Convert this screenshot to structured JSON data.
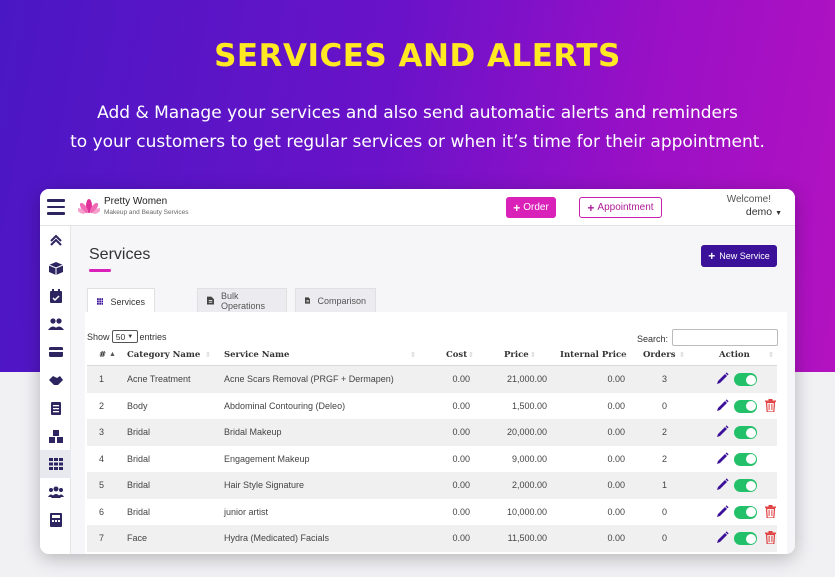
{
  "hero": {
    "title": "SERVICES AND ALERTS",
    "subtitle_line1": "Add & Manage your services and also send automatic alerts and reminders",
    "subtitle_line2": "to your customers to get regular services or when it’s time for their appointment."
  },
  "colors": {
    "accent_magenta": "#d920b9",
    "primary_purple": "#3b1199",
    "title_yellow": "#ffe923",
    "toggle_green": "#23c06a",
    "delete_red": "#e04040"
  },
  "topbar": {
    "brand_name": "Pretty Women",
    "brand_tagline": "Makeup and Beauty Services",
    "order_label": "Order",
    "appointment_label": "Appointment",
    "welcome_text": "Welcome!",
    "user_name": "demo"
  },
  "sidebar": {
    "items": [
      {
        "icon": "chevrons-up-icon"
      },
      {
        "icon": "boxes-icon"
      },
      {
        "icon": "calendar-check-icon"
      },
      {
        "icon": "users-icon"
      },
      {
        "icon": "credit-card-icon"
      },
      {
        "icon": "handshake-icon"
      },
      {
        "icon": "clipboard-icon"
      },
      {
        "icon": "inventory-icon"
      },
      {
        "icon": "services-grid-icon",
        "active": true
      },
      {
        "icon": "staff-icon"
      },
      {
        "icon": "calculator-icon"
      }
    ]
  },
  "page": {
    "title": "Services",
    "new_button_label": "New Service",
    "tabs": [
      {
        "label": "Services",
        "icon": "grid-icon",
        "active": true
      },
      {
        "label": "Bulk Operations",
        "icon": "file-icon"
      },
      {
        "label": "Comparison",
        "icon": "file-icon"
      }
    ],
    "show_label": "Show",
    "entries_value": "50",
    "entries_label": "entries",
    "search_label": "Search:"
  },
  "table": {
    "columns": [
      "#",
      "Category Name",
      "Service Name",
      "Cost",
      "Price",
      "Internal Price",
      "Orders",
      "Action"
    ],
    "rows": [
      {
        "n": "1",
        "category": "Acne Treatment",
        "service": "Acne Scars Removal (PRGF + Dermapen)",
        "cost": "0.00",
        "price": "21,000.00",
        "internal": "0.00",
        "orders": "3",
        "deletable": false
      },
      {
        "n": "2",
        "category": "Body",
        "service": "Abdominal Contouring (Deleo)",
        "cost": "0.00",
        "price": "1,500.00",
        "internal": "0.00",
        "orders": "0",
        "deletable": true
      },
      {
        "n": "3",
        "category": "Bridal",
        "service": "Bridal Makeup",
        "cost": "0.00",
        "price": "20,000.00",
        "internal": "0.00",
        "orders": "2",
        "deletable": false
      },
      {
        "n": "4",
        "category": "Bridal",
        "service": "Engagement Makeup",
        "cost": "0.00",
        "price": "9,000.00",
        "internal": "0.00",
        "orders": "2",
        "deletable": false
      },
      {
        "n": "5",
        "category": "Bridal",
        "service": "Hair Style Signature",
        "cost": "0.00",
        "price": "2,000.00",
        "internal": "0.00",
        "orders": "1",
        "deletable": false
      },
      {
        "n": "6",
        "category": "Bridal",
        "service": "junior artist",
        "cost": "0.00",
        "price": "10,000.00",
        "internal": "0.00",
        "orders": "0",
        "deletable": true
      },
      {
        "n": "7",
        "category": "Face",
        "service": "Hydra (Medicated) Facials",
        "cost": "0.00",
        "price": "11,500.00",
        "internal": "0.00",
        "orders": "0",
        "deletable": true
      }
    ]
  }
}
